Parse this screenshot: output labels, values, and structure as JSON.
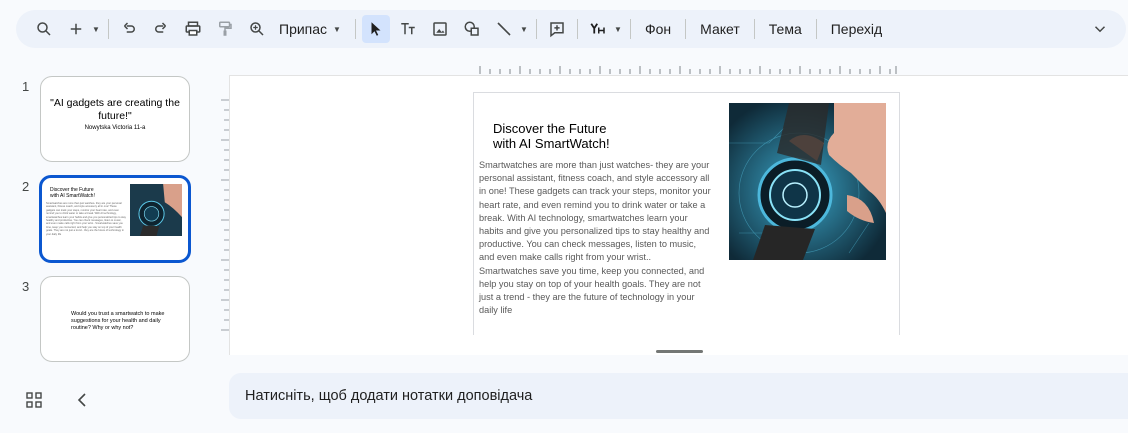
{
  "toolbar": {
    "fit_label": "Припас",
    "items": [
      "Фон",
      "Макет",
      "Тема",
      "Перехід"
    ]
  },
  "filmstrip": {
    "slides": [
      {
        "number": "1",
        "title": "\"AI gadgets are creating the future!\"",
        "subtitle": "Nowytska Victoria 11-a"
      },
      {
        "number": "2",
        "title": "Discover the Future\nwith AI SmartWatch!"
      },
      {
        "number": "3",
        "text": "Would you trust a smartwatch to make suggestions for your health and daily routine? Why or why not?"
      }
    ]
  },
  "slide": {
    "title_line1": "Discover the Future",
    "title_line2": "with AI SmartWatch!",
    "body": "Smartwatches are more than just watches- they are your personal assistant, fitness coach, and style accessory all in one! These gadgets can track your steps, monitor your heart rate, and even remind you to drink water or take a break. With AI technology, smartwatches learn your habits and give you personalized tips to stay healthy and productive. You can check messages, listen to music, and even make calls right from your wrist.. Smartwatches save you time, keep you connected, and help you stay on top of your health goals. They are not just a trend - they are the future of technology in your daily life"
  },
  "notes": {
    "placeholder": "Натисніть, щоб додати нотатки доповідача"
  },
  "colors": {
    "accent": "#0b57d0",
    "toolbar_bg": "#edf2fa"
  }
}
